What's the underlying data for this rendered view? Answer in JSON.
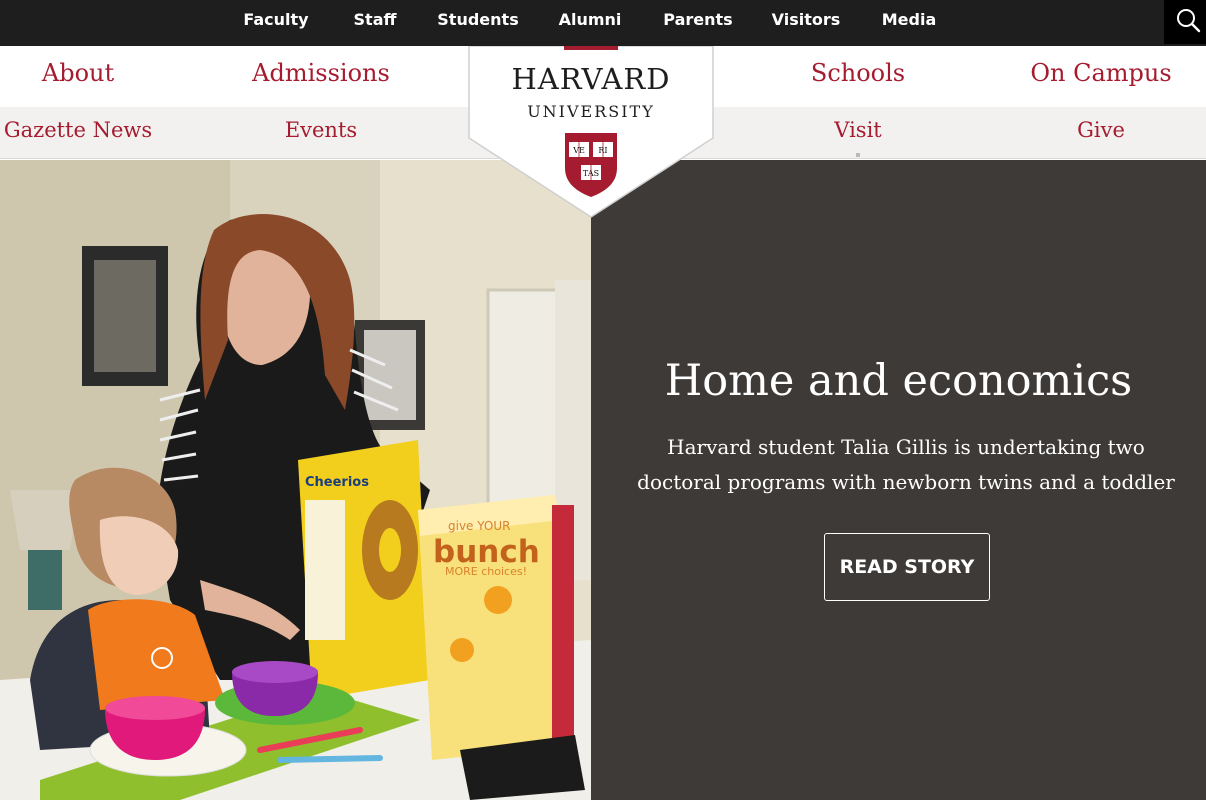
{
  "audience_nav": [
    "Faculty",
    "Staff",
    "Students",
    "Alumni",
    "Parents",
    "Visitors",
    "Media"
  ],
  "search": {
    "icon": "search-icon"
  },
  "primary_nav": [
    "About",
    "Admissions",
    "Schools",
    "On Campus"
  ],
  "secondary_nav": [
    "Gazette News",
    "Events",
    "Visit",
    "Give"
  ],
  "logo": {
    "line1": "HARVARD",
    "line2": "UNIVERSITY",
    "shield_text": [
      "VE",
      "RI",
      "TAS"
    ]
  },
  "hero": {
    "title": "Home and economics",
    "subtitle": "Harvard student Talia Gillis is undertaking two doctoral programs with newborn twins and a toddler",
    "button_label": "READ STORY",
    "photo": {
      "box1_label": "Cheerios",
      "box2_line1": "give YOUR",
      "box2_line2": "bunch",
      "box2_line3": "MORE choices!"
    }
  },
  "colors": {
    "crimson": "#a51c30",
    "topbar": "#1e1e1e",
    "panel": "#3e3a37"
  }
}
